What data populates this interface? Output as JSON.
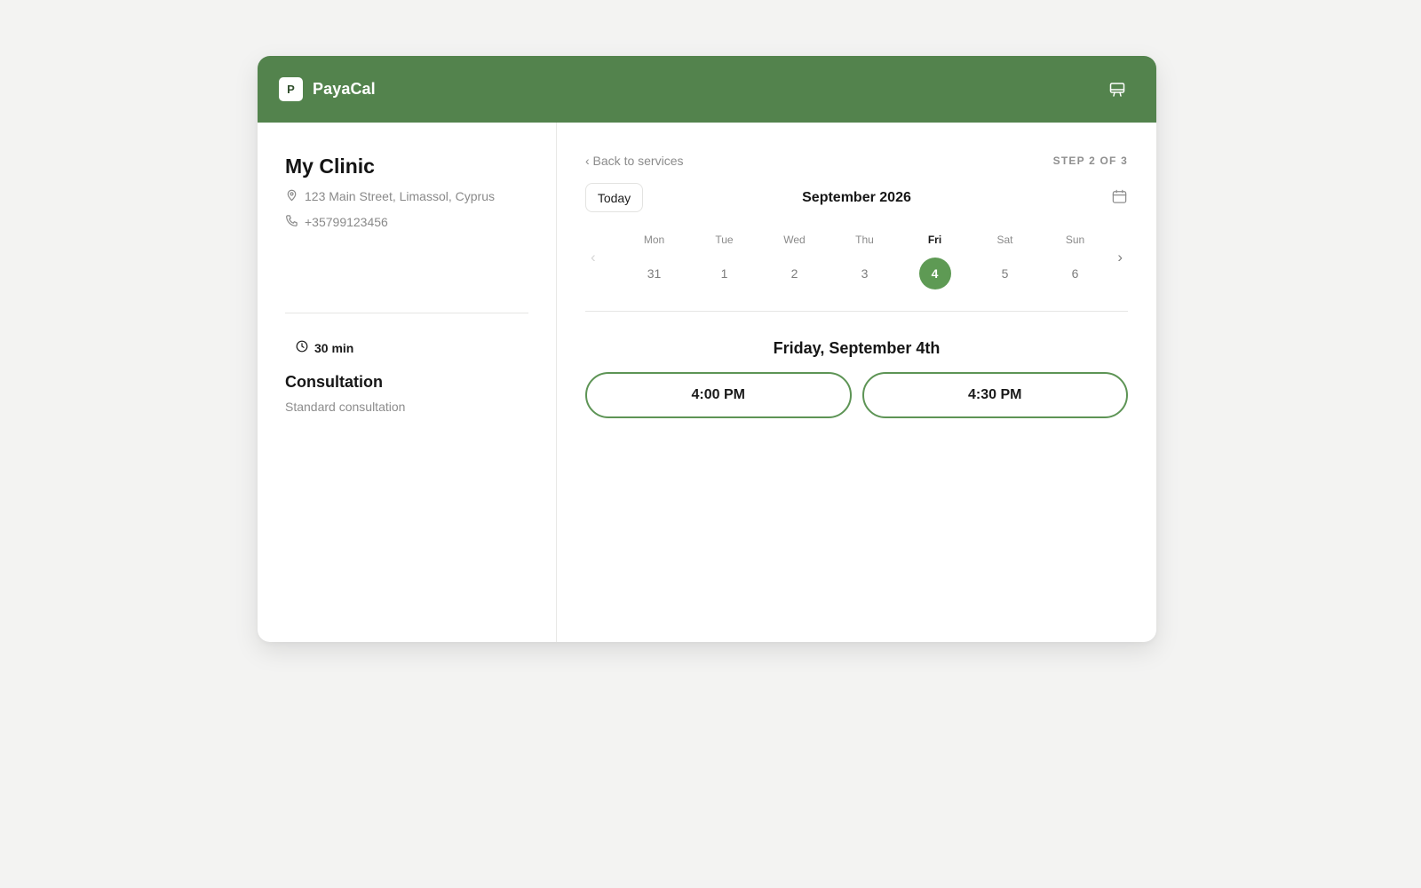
{
  "header": {
    "logo_letter": "P",
    "brand": "PayaCal",
    "icon": "presentation-icon",
    "color": "#53834d"
  },
  "clinic": {
    "name": "My Clinic",
    "address": "123 Main Street, Limassol, Cyprus",
    "phone": "+35799123456"
  },
  "service": {
    "duration": "30 min",
    "name": "Consultation",
    "description": "Standard consultation"
  },
  "booking": {
    "back_label": "‹ Back to services",
    "step_label": "STEP 2 OF 3",
    "today_label": "Today",
    "month_label": "September 2026",
    "prev_label": "‹",
    "next_label": "›",
    "days": [
      {
        "dow": "Mon",
        "num": "31"
      },
      {
        "dow": "Tue",
        "num": "1"
      },
      {
        "dow": "Wed",
        "num": "2"
      },
      {
        "dow": "Thu",
        "num": "3"
      },
      {
        "dow": "Fri",
        "num": "4",
        "selected": true
      },
      {
        "dow": "Sat",
        "num": "5"
      },
      {
        "dow": "Sun",
        "num": "6"
      }
    ],
    "selected_date_label": "Friday, September 4th",
    "slots": [
      "4:00 PM",
      "4:30 PM"
    ],
    "accent_color": "#5e9a54"
  }
}
